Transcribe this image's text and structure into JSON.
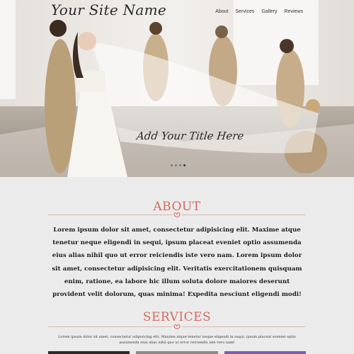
{
  "header": {
    "site_name": "Your Site Name",
    "nav": [
      "About",
      "Services",
      "Gallery",
      "Reviews"
    ]
  },
  "hero": {
    "title": "Add Your Title Here",
    "slides_count": 4,
    "active_slide": 4
  },
  "about": {
    "title": "ABOUT",
    "body": "Lorem ipsum dolor sit amet, consectetur adipisicing elit. Maxime atque tenetur neque eligendi in sequi, ipsum placeat eveniet optio assumenda eius alias nihil quo ut error reiciendis iste vero nam. Lorem ipsum dolor sit amet, consectetur adipisicing elit. Veritatis exercitationem quisquam enim, ratione, ea labore hic illum soluta dolore maiores deserunt provident velit dolorum, quas minima! Expedita nesciunt eligendi modi!"
  },
  "services": {
    "title": "SERVICES",
    "body": "Lorem ipsum dolor sit amet, consectetur adipisicing elit. Maxime atque tenetur neque eligendi in sequi, ipsum placeat eveniet optio assumenda eius alias nihil quo ut error reiciendis iste vero nam!"
  },
  "colors": {
    "accent": "#d46a5e",
    "background": "#ebebeb"
  }
}
